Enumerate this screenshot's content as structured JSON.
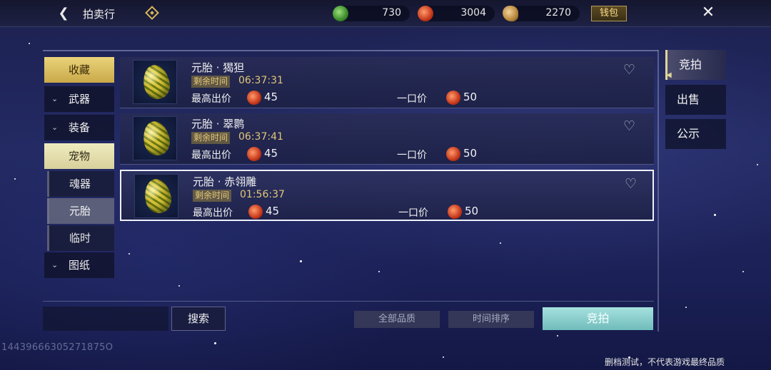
{
  "header": {
    "title": "拍卖行",
    "currencies": [
      {
        "name": "jade-coin-icon",
        "amount": "730"
      },
      {
        "name": "red-coin-icon",
        "amount": "3004"
      },
      {
        "name": "bronze-coin-icon",
        "amount": "2270"
      }
    ],
    "wallet_label": "钱包"
  },
  "categories": [
    {
      "label": "收藏"
    },
    {
      "label": "武器"
    },
    {
      "label": "装备"
    },
    {
      "label": "宠物"
    }
  ],
  "subcategories": [
    {
      "label": "魂器"
    },
    {
      "label": "元胎"
    },
    {
      "label": "临时"
    }
  ],
  "extra_category": {
    "label": "图纸"
  },
  "items": [
    {
      "name": "元胎 · 猲狚",
      "time_label": "剩余时间",
      "time": "06:37:31",
      "bid_label": "最高出价",
      "bid": "45",
      "buyout_label": "一口价",
      "buyout": "50"
    },
    {
      "name": "元胎 · 翠鹮",
      "time_label": "剩余时间",
      "time": "06:37:41",
      "bid_label": "最高出价",
      "bid": "45",
      "buyout_label": "一口价",
      "buyout": "50"
    },
    {
      "name": "元胎 · 赤翎雕",
      "time_label": "剩余时间",
      "time": "01:56:37",
      "bid_label": "最高出价",
      "bid": "45",
      "buyout_label": "一口价",
      "buyout": "50"
    }
  ],
  "right_tabs": [
    {
      "label": "竞拍"
    },
    {
      "label": "出售"
    },
    {
      "label": "公示"
    }
  ],
  "bottom": {
    "search_label": "搜索",
    "quality_filter": "全部品质",
    "time_sort": "时间排序",
    "bid_button": "竞拍"
  },
  "player_id": "14439666305271875O",
  "disclaimer": "删档测试，不代表游戏最终品质",
  "colors": {
    "accent_gold": "#d9b65a",
    "bid_button": "#8fcfcd",
    "time_text": "#e3c678"
  }
}
